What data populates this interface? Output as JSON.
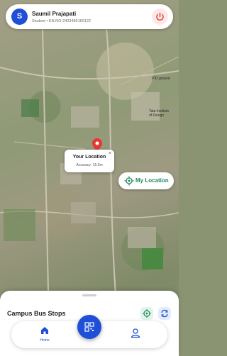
{
  "user": {
    "initial": "S",
    "name": "Saumil Prajapati",
    "subtitle": "Student • EN.NO-2403486160122"
  },
  "map": {
    "labels": [
      "PIO ground",
      "Tata Institute of Design"
    ]
  },
  "marker_popup": {
    "title": "Your Location",
    "accuracy": "Accuracy: 15.9m",
    "close": "×"
  },
  "my_location_button": {
    "label": "My Location"
  },
  "bottom_sheet": {
    "title": "Campus Bus Stops"
  },
  "nav": {
    "home_label": "Home"
  },
  "colors": {
    "brand_blue": "#1e4fd6",
    "accent_green": "#1d8a5a",
    "danger_red": "#e53935"
  },
  "icons": {
    "power": "power-icon",
    "locate": "locate-icon",
    "refresh": "refresh-icon",
    "home": "home-icon",
    "qr": "qr-icon",
    "profile": "profile-icon",
    "navigation": "navigation-arrow-icon"
  }
}
